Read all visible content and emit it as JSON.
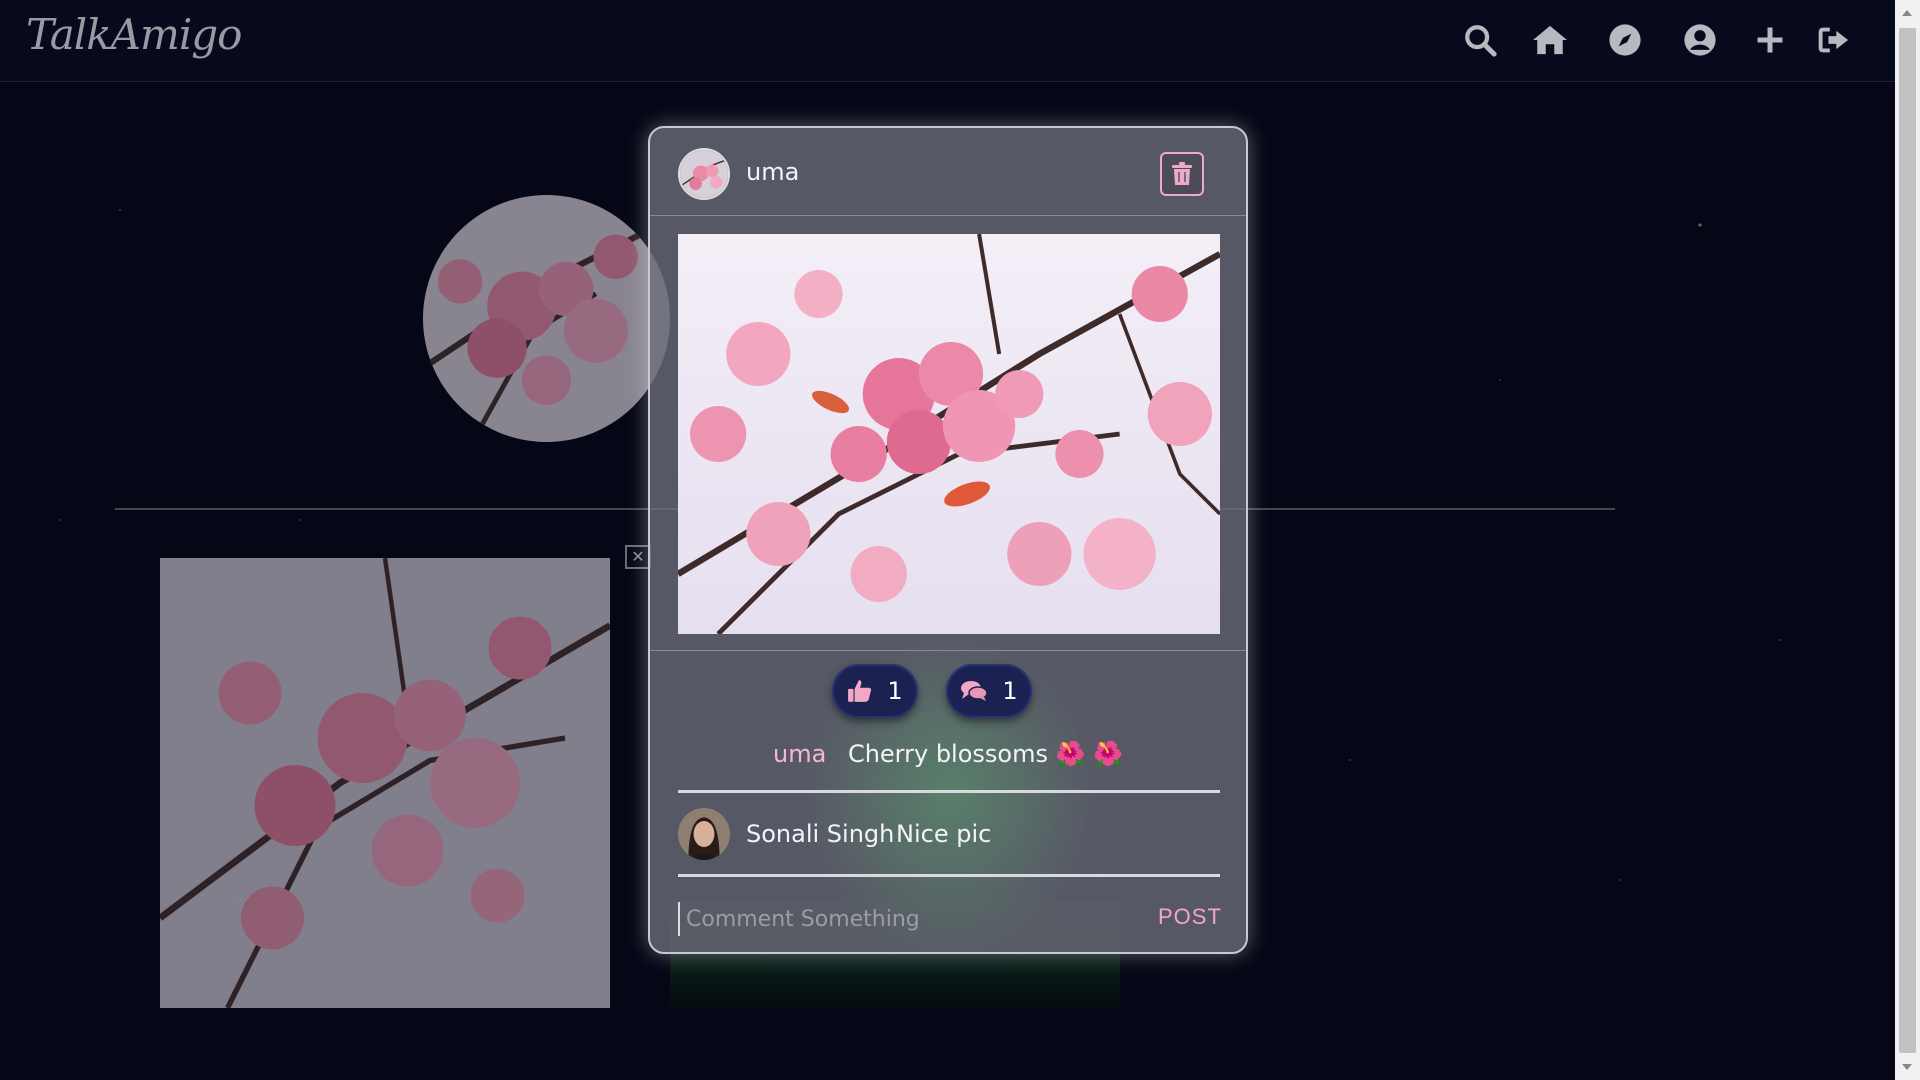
{
  "app": {
    "logo": "TalkAmigo"
  },
  "navbar": {
    "icons": [
      "search-icon",
      "home-icon",
      "explore-compass-icon",
      "profile-icon",
      "add-icon",
      "logout-icon"
    ]
  },
  "modal": {
    "username": "uma",
    "likes": "1",
    "comments_count": "1",
    "caption_user": "uma",
    "caption_text": "Cherry blossoms 🌺 🌺",
    "comments": [
      {
        "name": "Sonali Singh",
        "text": "Nice pic"
      }
    ],
    "comment_placeholder": "Comment Something",
    "post_label": "POST"
  },
  "colors": {
    "accent_pink": "#f5a6c4",
    "pill_bg": "#1b2150",
    "background": "#050716"
  }
}
